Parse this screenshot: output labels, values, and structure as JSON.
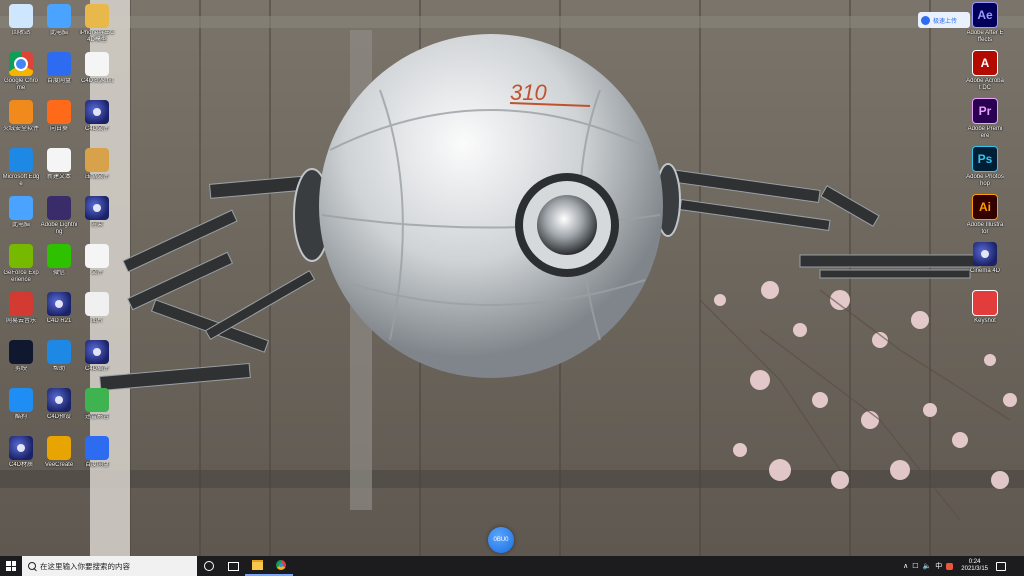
{
  "desktop": {
    "left_icons": [
      {
        "label": "回收站",
        "icon": "recycle-bin-icon",
        "color": "#cfe6ff"
      },
      {
        "label": "此电脑",
        "icon": "computer-icon",
        "color": "#4aa3ff"
      },
      {
        "label": "iPhone导出C4D模型",
        "icon": "folder-icon",
        "color": "#e8b84a"
      },
      {
        "label": "Google Chrome",
        "icon": "chrome-icon",
        "color": "#4285f4"
      },
      {
        "label": "百度网盘",
        "icon": "baidu-netdisk-icon",
        "color": "#2d6cf0"
      },
      {
        "label": "C4D资源.txt",
        "icon": "text-file-icon",
        "color": "#f5f5f5"
      },
      {
        "label": "火绒安全软件",
        "icon": "huorong-icon",
        "color": "#f08a1c"
      },
      {
        "label": "向日葵",
        "icon": "sunlogin-icon",
        "color": "#ff6a1a"
      },
      {
        "label": "C4D文件",
        "icon": "cinema4d-icon",
        "color": "#2a3890"
      },
      {
        "label": "Microsoft Edge",
        "icon": "edge-icon",
        "color": "#1e88e5"
      },
      {
        "label": "新建文本",
        "icon": "document-icon",
        "color": "#f5f5f5"
      },
      {
        "label": "压缩文件",
        "icon": "archive-icon",
        "color": "#d8a24a"
      },
      {
        "label": "此电脑",
        "icon": "pc-icon",
        "color": "#4aa3ff"
      },
      {
        "label": "Adobe Lightning",
        "icon": "adobe-icon",
        "color": "#3a2b6b"
      },
      {
        "label": "渲染",
        "icon": "cinema4d-icon",
        "color": "#2a3890"
      },
      {
        "label": "GeForce Experience",
        "icon": "nvidia-icon",
        "color": "#76b900"
      },
      {
        "label": "微信",
        "icon": "wechat-icon",
        "color": "#2dc100"
      },
      {
        "label": "文件",
        "icon": "document-icon",
        "color": "#f5f5f5"
      },
      {
        "label": "网易云音乐",
        "icon": "music-icon",
        "color": "#d33a31"
      },
      {
        "label": "C4D R21",
        "icon": "cinema4d-icon",
        "color": "#2a3890"
      },
      {
        "label": "图片",
        "icon": "image-icon",
        "color": "#f0f0f0"
      },
      {
        "label": "剪映",
        "icon": "video-editor-icon",
        "color": "#101830"
      },
      {
        "label": "帮助",
        "icon": "help-icon",
        "color": "#1e88e5"
      },
      {
        "label": "C4D插件",
        "icon": "cinema4d-icon",
        "color": "#2a3890"
      },
      {
        "label": "酷狗",
        "icon": "kugou-icon",
        "color": "#1e8ef5"
      },
      {
        "label": "C4D预设",
        "icon": "cinema4d-icon",
        "color": "#2a3890"
      },
      {
        "label": "迅雷影音",
        "icon": "player-icon",
        "color": "#3fb34f"
      },
      {
        "label": "C4D材质",
        "icon": "cinema4d-icon",
        "color": "#2a3890"
      },
      {
        "label": "VeeCreate",
        "icon": "app-icon",
        "color": "#e8a400"
      },
      {
        "label": "百度网盘",
        "icon": "baidu-icon",
        "color": "#2d6cf0"
      }
    ],
    "right_icons": [
      {
        "label": "Adobe After Effects",
        "abbr": "Ae",
        "icon": "after-effects-icon",
        "color": "#9999ff",
        "bg": "#00005b"
      },
      {
        "label": "Adobe Acrobat DC",
        "abbr": "A",
        "icon": "acrobat-icon",
        "color": "#ffffff",
        "bg": "#b30b00"
      },
      {
        "label": "Adobe Premiere",
        "abbr": "Pr",
        "icon": "premiere-icon",
        "color": "#e9a0ff",
        "bg": "#2a0053"
      },
      {
        "label": "Adobe Photoshop",
        "abbr": "Ps",
        "icon": "photoshop-icon",
        "color": "#31c5f0",
        "bg": "#001e36"
      },
      {
        "label": "Adobe Illustrator",
        "abbr": "Ai",
        "icon": "illustrator-icon",
        "color": "#ff9a00",
        "bg": "#330000"
      },
      {
        "label": "Cinema 4D",
        "abbr": "",
        "icon": "cinema4d-icon",
        "color": "#ffffff",
        "bg": "#2a3890"
      },
      {
        "label": "Keyshot",
        "abbr": "",
        "icon": "keyshot-icon",
        "color": "#ffffff",
        "bg": "#e23c3c"
      }
    ]
  },
  "upload_widget": {
    "label": "极速上传"
  },
  "floating_ball": {
    "label": "0BU0"
  },
  "wallpaper": {
    "logo_text": "310"
  },
  "taskbar": {
    "search_placeholder": "在这里输入你要搜索的内容",
    "tray": {
      "chevron": "∧",
      "volume": "🔈",
      "network": "☐",
      "ime": "中"
    },
    "clock": {
      "time": "0:24",
      "date": "2021/3/15"
    }
  }
}
